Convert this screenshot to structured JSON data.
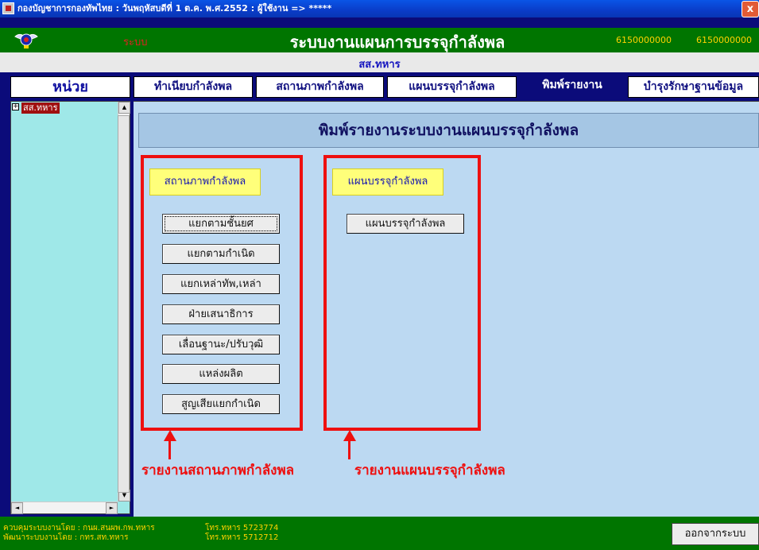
{
  "window": {
    "title": "กองบัญชาการกองทัพไทย : วันพฤหัสบดีที่ 1 ต.ค.  พ.ศ.2552 : ผู้ใช้งาน => *****",
    "close_label": "x"
  },
  "header": {
    "red_tag": "ระบบ",
    "system_title": "ระบบงานแผนการบรรจุกำลังพล",
    "number_1": "6150000000",
    "number_2": "6150000000"
  },
  "unit_name": "สส.ทหาร",
  "sidebar": {
    "header": "หน่วย",
    "tree": {
      "expander": "+",
      "item": "สส.ทหาร"
    }
  },
  "tabs": [
    {
      "label": "ทำเนียบกำลังพล",
      "active": false
    },
    {
      "label": "สถานภาพกำลังพล",
      "active": false
    },
    {
      "label": "แผนบรรจุกำลังพล",
      "active": false
    },
    {
      "label": "พิมพ์รายงาน",
      "active": true
    },
    {
      "label": "บำรุงรักษาฐานข้อมูล",
      "active": false
    }
  ],
  "main": {
    "title": "พิมพ์รายงานระบบงานแผนบรรจุกำลังพล",
    "status_group": {
      "header": "สถานภาพกำลังพล",
      "buttons": [
        "แยกตามชั้นยศ",
        "แยกตามกำเนิด",
        "แยกเหล่าทัพ,เหล่า",
        "ฝ่ายเสนาธิการ",
        "เลื่อนฐานะ/ปรับวุฒิ",
        "แหล่งผลิต",
        "สูญเสียแยกกำเนิด"
      ]
    },
    "plan_group": {
      "header": "แผนบรรจุกำลังพล",
      "buttons": [
        "แผนบรรจุกำลังพล"
      ]
    },
    "annotations": {
      "left": "รายงานสถานภาพกำลังพล",
      "right": "รายงานแผนบรรจุกำลังพล"
    }
  },
  "footer": {
    "line1_label": "ควบคุมระบบงานโดย : กนผ.สนผพ.กพ.ทหาร",
    "line1_phone": "โทร.ทหาร  5723774",
    "line2_label": "พัฒนาระบบงานโดย : กทร.สท.ทหาร",
    "line2_phone": "โทร.ทหาร  5712712",
    "exit_label": "ออกจากระบบ"
  },
  "colors": {
    "navy": "#0b0b7a",
    "green": "#007500",
    "highlight_red": "#ee1010",
    "yellow_label": "#ffff7a",
    "panel_blue": "#bcd9f2"
  }
}
